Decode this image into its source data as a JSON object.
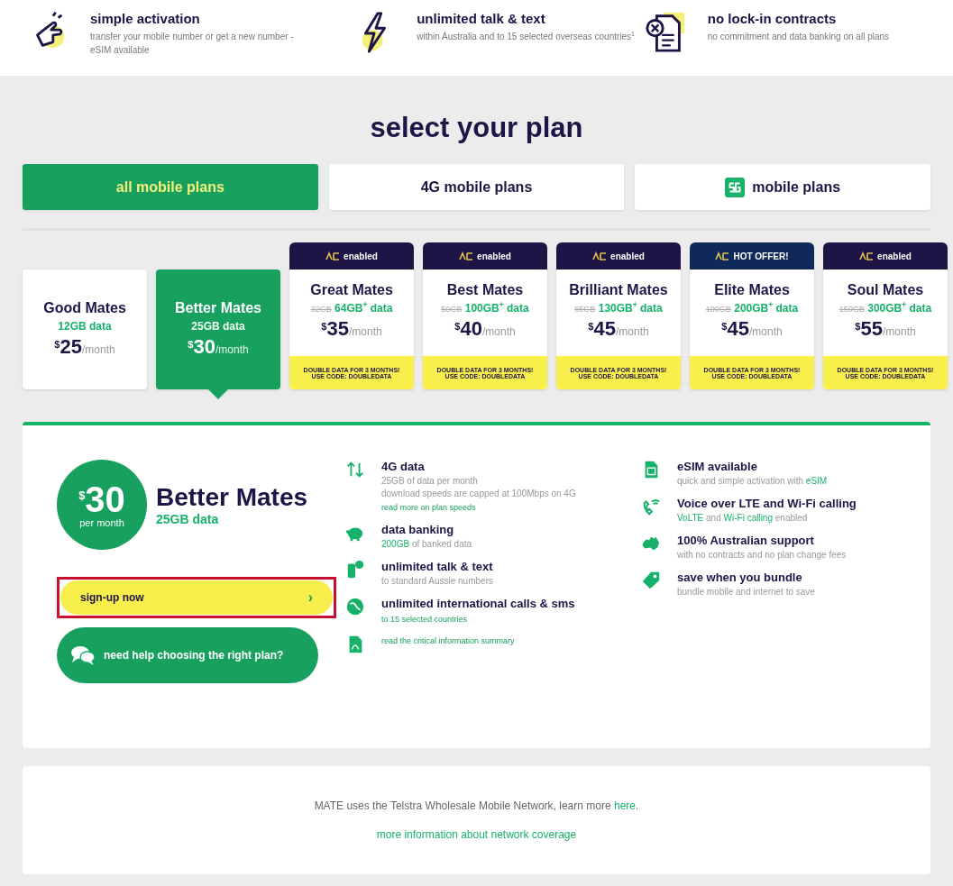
{
  "features": [
    {
      "kind": "hand",
      "title": "simple activation",
      "text": "transfer your mobile number or get a new number - eSIM available"
    },
    {
      "kind": "bolt",
      "title": "unlimited talk & text",
      "text": "within Australia and to 15 selected overseas countries$^{1}$"
    },
    {
      "kind": "document",
      "title": "no lock-in contracts",
      "text": "no commitment and data banking on all plans"
    }
  ],
  "heading": "select your plan",
  "tabs": [
    {
      "label": "all mobile plans",
      "selected": true,
      "badge": false
    },
    {
      "label": "4G mobile plans",
      "selected": false,
      "badge": false
    },
    {
      "label": "mobile plans",
      "selected": false,
      "badge": true
    }
  ],
  "plans": [
    {
      "name": "Good Mates",
      "data": "12GB data",
      "currency": "$",
      "amount": "25",
      "period": "/month",
      "selected": false
    },
    {
      "name": "Better Mates",
      "data": "25GB data",
      "currency": "$",
      "amount": "30",
      "period": "/month",
      "selected": true
    },
    {
      "name": "Great Mates",
      "old_data": "32GB",
      "data": "64GB$^{+}$ data",
      "currency": "$",
      "amount": "35",
      "period": "/month",
      "selected": false,
      "badge": "enabled",
      "color": "#1e1446",
      "promo": [
        "DOUBLE DATA FOR 3 MONTHS!",
        "USE CODE: DOUBLEDATA"
      ]
    },
    {
      "name": "Best Mates",
      "old_data": "50GB",
      "data": "100GB$^{+}$ data",
      "currency": "$",
      "amount": "40",
      "period": "/month",
      "selected": false,
      "badge": "enabled",
      "color": "#1e1446",
      "promo": [
        "DOUBLE DATA FOR 3 MONTHS!",
        "USE CODE: DOUBLEDATA"
      ]
    },
    {
      "name": "Brilliant Mates",
      "old_data": "65GB",
      "data": "130GB$^{+}$ data",
      "currency": "$",
      "amount": "45",
      "period": "/month",
      "selected": false,
      "badge": "enabled",
      "color": "#1e1446",
      "promo": [
        "DOUBLE DATA FOR 3 MONTHS!",
        "USE CODE: DOUBLEDATA"
      ]
    },
    {
      "name": "Elite Mates",
      "old_data": "100GB",
      "data": "200GB$^{+}$ data",
      "currency": "$",
      "amount": "45",
      "period": "/month",
      "selected": false,
      "badge": "HOT OFFER!",
      "color": "#0f2a5a",
      "promo": [
        "DOUBLE DATA FOR 3 MONTHS!",
        "USE CODE: DOUBLEDATA"
      ]
    },
    {
      "name": "Soul Mates",
      "old_data": "150GB",
      "data": "300GB$^{+}$ data",
      "currency": "$",
      "amount": "55",
      "period": "/month",
      "selected": false,
      "badge": "enabled",
      "color": "#1e1446",
      "promo": [
        "DOUBLE DATA FOR 3 MONTHS!",
        "USE CODE: DOUBLEDATA"
      ]
    }
  ],
  "detail": {
    "currency": "$",
    "amount": "30",
    "per": "per month",
    "name": "Better Mates",
    "data": "25GB data",
    "signup": {
      "label": "sign-up now",
      "chevron": "›",
      "highlighted": true
    },
    "help": "need help choosing the right plan?",
    "columns": [
      [
        {
          "kind": "arrows",
          "title": "4G data",
          "lines": [
            [
              {
                "text": "25GB of data per month",
                "green": false
              }
            ],
            [
              {
                "text": "download speeds are capped at 100Mbps on 4G",
                "green": false
              }
            ]
          ],
          "link": "read more on plan speeds"
        },
        {
          "kind": "piggy",
          "title": "data banking",
          "lines": [
            [
              {
                "text": "200GB",
                "green": true
              },
              {
                "text": " of banked data",
                "green": false
              }
            ]
          ]
        },
        {
          "kind": "phone",
          "title": "unlimited talk & text",
          "lines": [
            [
              {
                "text": "to standard Aussie numbers",
                "green": false
              }
            ]
          ]
        },
        {
          "kind": "globe",
          "title": "unlimited international calls & sms",
          "link": "to 15 selected countries"
        },
        {
          "kind": "pdf",
          "link": "read the critical information summary"
        }
      ],
      [
        {
          "kind": "sim",
          "title": "eSIM available",
          "lines": [
            [
              {
                "text": "quick and simple activation with ",
                "green": false
              },
              {
                "text": "eSIM",
                "green": true
              }
            ]
          ]
        },
        {
          "kind": "wifi",
          "title": "Voice over LTE and Wi-Fi calling",
          "lines": [
            [
              {
                "text": "VoLTE",
                "green": true
              },
              {
                "text": " and ",
                "green": false
              },
              {
                "text": "Wi-Fi calling",
                "green": true
              },
              {
                "text": " enabled",
                "green": false
              }
            ]
          ]
        },
        {
          "kind": "australia",
          "title": "100% Australian support",
          "lines": [
            [
              {
                "text": "with no contracts and no plan change fees",
                "green": false
              }
            ]
          ]
        },
        {
          "kind": "tag",
          "title": "save when you bundle",
          "lines": [
            [
              {
                "text": "bundle mobile and internet to save",
                "green": false
              }
            ]
          ]
        }
      ]
    ]
  },
  "footer": {
    "text": "MATE uses the Telstra Wholesale Mobile Network, learn more ",
    "link": "here",
    "end": ".",
    "coverage": "more information about network coverage"
  }
}
